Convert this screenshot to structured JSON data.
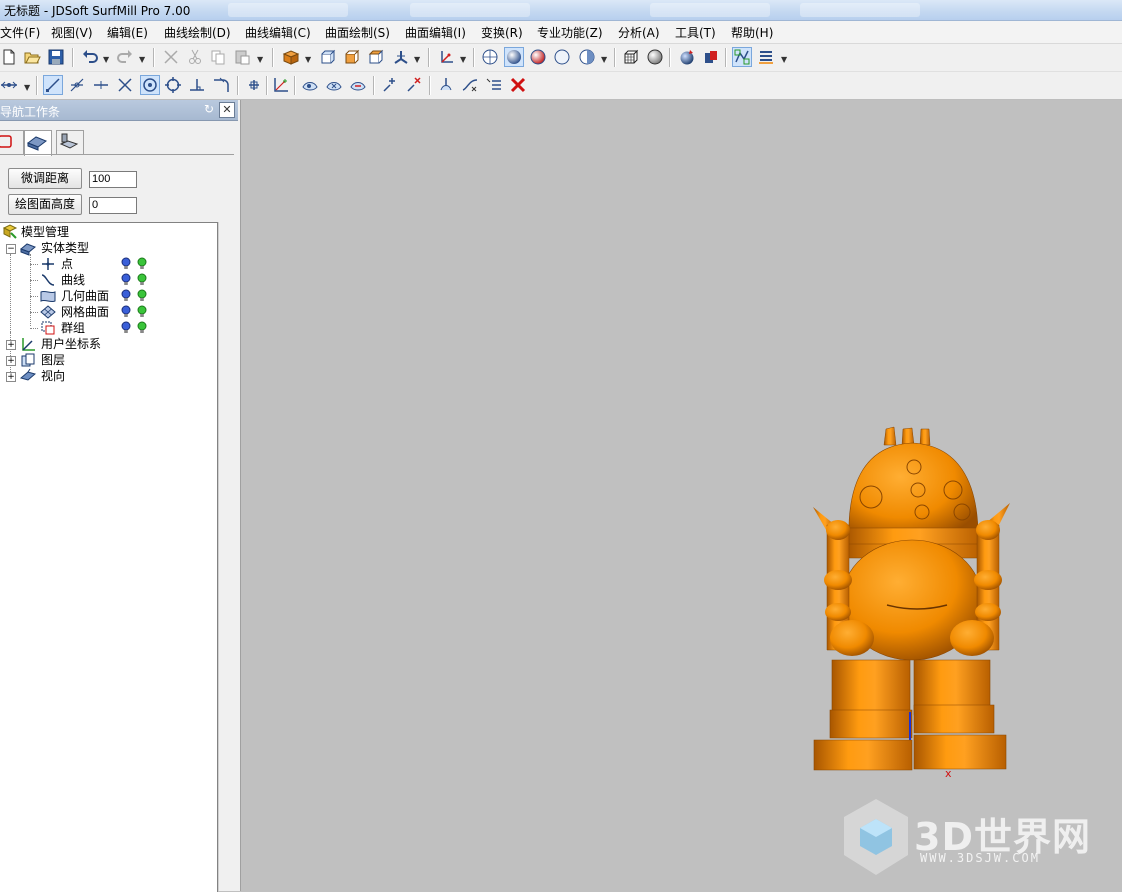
{
  "window": {
    "title": "无标题 - JDSoft SurfMill Pro 7.00"
  },
  "menu": [
    "文件(F)",
    "视图(V)",
    "编辑(E)",
    "曲线绘制(D)",
    "曲线编辑(C)",
    "曲面绘制(S)",
    "曲面编辑(I)",
    "变换(R)",
    "专业功能(Z)",
    "分析(A)",
    "工具(T)",
    "帮助(H)"
  ],
  "toolbar1": [
    "new-file-icon",
    "open-folder-icon",
    "save-icon",
    "undo-icon",
    "redo-icon",
    "cut-icon",
    "scissors-icon",
    "copy-icon",
    "paste-icon",
    "box-view-icon",
    "iso-view-icon",
    "front-view-icon",
    "top-view-icon",
    "axis-view-icon",
    "coordinate-icon",
    "wireframe-sphere-icon",
    "shaded-sphere-icon",
    "red-sphere-icon",
    "outline-sphere-icon",
    "render-mode-icon",
    "mesh-cube-icon",
    "gray-sphere-icon",
    "material-sphere-icon",
    "color-icon",
    "select-filter-icon",
    "layers-list-icon"
  ],
  "toolbar2": [
    "point-snap-icon",
    "line-icon",
    "tangent-icon",
    "midpoint-icon",
    "intersect-icon",
    "center-icon",
    "quadrant-icon",
    "perpendicular-icon",
    "tangent-curve-icon",
    "grid-icon",
    "axis-snap-icon",
    "surface-snap-1-icon",
    "surface-snap-2-icon",
    "surface-snap-3-icon",
    "cursor-plus-icon",
    "cursor-x-icon",
    "pick-icon",
    "curve-edit-icon",
    "list-edit-icon",
    "delete-x-icon"
  ],
  "panel": {
    "title": "导航工作条",
    "fine_tune_button": "微调距离",
    "fine_tune_value": "100",
    "draw_height_button": "绘图面高度",
    "draw_height_value": "0",
    "tree": {
      "root": "模型管理",
      "entity_types": "实体类型",
      "point": "点",
      "curve": "曲线",
      "geometric_surface": "几何曲面",
      "mesh_surface": "网格曲面",
      "group": "群组",
      "user_coords": "用户坐标系",
      "layers": "图层",
      "view_direction": "视向"
    }
  },
  "viewport": {
    "background": "#c0c0c0",
    "model_color": "#ff8c00",
    "axis_x_label": "x"
  },
  "watermark": {
    "text": "3D世界网",
    "url": "WWW.3DSJW.COM"
  }
}
